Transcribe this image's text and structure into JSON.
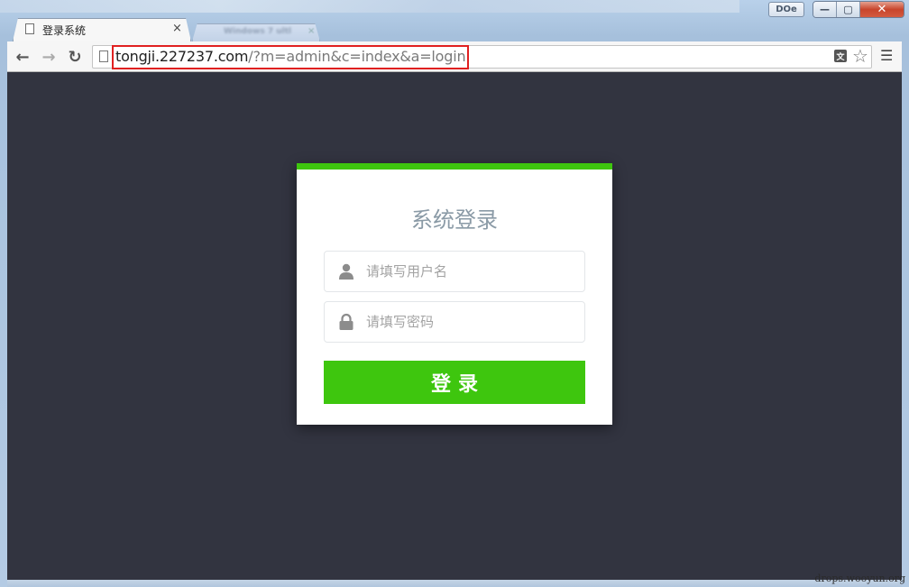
{
  "browser": {
    "user_badge": "DOe",
    "caption": {
      "minimize": "—",
      "maximize": "▢",
      "close": "✕"
    },
    "tabs": [
      {
        "title": "登录系统",
        "active": true,
        "close": "×"
      },
      {
        "title": "Windows 7 ultl",
        "active": false,
        "close": "×"
      }
    ],
    "url": {
      "host": "tongji.227237.com",
      "path": "/?m=admin&c=index&a=login"
    },
    "icons": [
      "back-icon",
      "forward-icon",
      "reload-icon",
      "page-icon",
      "translate-icon",
      "star-icon",
      "menu-icon"
    ]
  },
  "login": {
    "title": "系统登录",
    "username_placeholder": "请填写用户名",
    "password_placeholder": "请填写密码",
    "submit_label": "登录",
    "accent_color": "#3ec60e",
    "background_color": "#323440"
  },
  "watermark": "drops.wooyun.org"
}
